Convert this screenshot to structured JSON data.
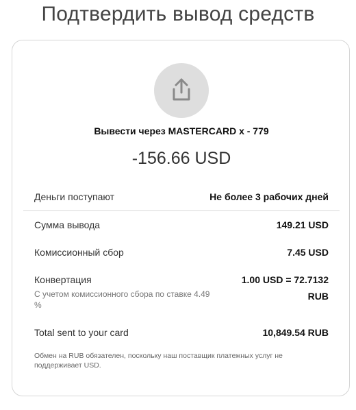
{
  "page": {
    "title": "Подтвердить вывод средств"
  },
  "summary": {
    "icon": "share-upload-icon",
    "method": "Вывести через MASTERCARD x - 779",
    "amount": "-156.66 USD"
  },
  "details": {
    "arrival_label": "Деньги поступают",
    "arrival_value": "Не более 3 рабочих дней",
    "sum_label": "Сумма вывода",
    "sum_value": "149.21 USD",
    "fee_label": "Комиссионный сбор",
    "fee_value": "7.45 USD",
    "conversion_label": "Конвертация",
    "conversion_note": "С учетом комиссионного сбора по ставке 4.49 %",
    "conversion_value": "1.00 USD = 72.7132 RUB",
    "total_label": "Total sent to your card",
    "total_value": "10,849.54 RUB"
  },
  "footnote": "Обмен на RUB обязателен, поскольку наш поставщик платежных услуг не поддерживает USD.",
  "colors": {
    "icon_background": "#dedede",
    "icon_stroke": "#8a8a8a",
    "card_border": "#d6d6d6"
  }
}
